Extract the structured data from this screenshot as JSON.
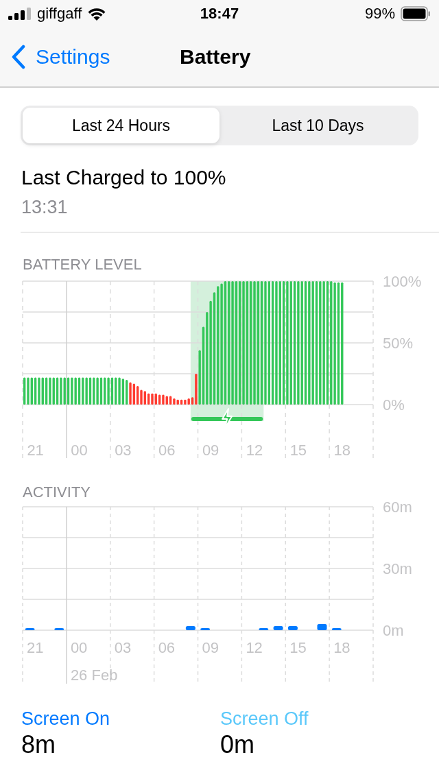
{
  "status_bar": {
    "carrier": "giffgaff",
    "time": "18:47",
    "battery": "99%"
  },
  "nav": {
    "back": "Settings",
    "title": "Battery"
  },
  "tabs": [
    {
      "label": "Last 24 Hours",
      "selected": true
    },
    {
      "label": "Last 10 Days",
      "selected": false
    }
  ],
  "last_charged": {
    "title": "Last Charged to 100%",
    "time": "13:31"
  },
  "battery_level": {
    "heading": "BATTERY LEVEL",
    "chart_data": {
      "type": "bar",
      "ylim": [
        0,
        100
      ],
      "categories": [
        null,
        null,
        null,
        "21",
        null,
        null,
        null,
        null,
        null,
        null,
        null,
        null,
        null,
        null,
        null,
        "00",
        null,
        null,
        null,
        null,
        null,
        null,
        null,
        null,
        null,
        null,
        null,
        "03",
        null,
        null,
        null,
        null,
        null,
        null,
        null,
        null,
        null,
        null,
        null,
        "06",
        null,
        null,
        null,
        null,
        null,
        null,
        null,
        null,
        null,
        null,
        null,
        "09",
        null,
        null,
        null,
        null,
        null,
        null,
        null,
        null,
        null,
        null,
        null,
        "12",
        null,
        null,
        null,
        null,
        null,
        null,
        null,
        null,
        null,
        null,
        null,
        "15",
        null,
        null,
        null,
        null,
        null,
        null,
        null,
        null,
        null,
        null,
        null,
        "18",
        null,
        null,
        null,
        null,
        null,
        null,
        null,
        null
      ],
      "yticks": [
        {
          "value": 0,
          "label": "0%"
        },
        {
          "value": 50,
          "label": "50%"
        },
        {
          "value": 100,
          "label": "100%"
        }
      ],
      "series": [
        {
          "color": "#34c759",
          "values": [
            22,
            22,
            22,
            22,
            22,
            22,
            22,
            22,
            22,
            22,
            22,
            22,
            22,
            22,
            22,
            22,
            22,
            22,
            22,
            22,
            22,
            22,
            22,
            22,
            22,
            22,
            22,
            21,
            20,
            null,
            null,
            null,
            null,
            null,
            null,
            null,
            null,
            null,
            null,
            null,
            null,
            null,
            null,
            null,
            null,
            null,
            null,
            null,
            44,
            63,
            75,
            84,
            91,
            96,
            98,
            100,
            100,
            100,
            100,
            100,
            100,
            100,
            100,
            100,
            100,
            100,
            100,
            100,
            100,
            100,
            100,
            100,
            100,
            100,
            100,
            100,
            100,
            100,
            100,
            100,
            100,
            100,
            100,
            100,
            100,
            99,
            99,
            99,
            null,
            null,
            null,
            null,
            null,
            null,
            null,
            null
          ]
        },
        {
          "color": "#ff3b30",
          "values": [
            null,
            null,
            null,
            null,
            null,
            null,
            null,
            null,
            null,
            null,
            null,
            null,
            null,
            null,
            null,
            null,
            null,
            null,
            null,
            null,
            null,
            null,
            null,
            null,
            null,
            null,
            null,
            null,
            null,
            18,
            17,
            15,
            12,
            11,
            9,
            9,
            9,
            8,
            8,
            7,
            7,
            5,
            4,
            4,
            4,
            5,
            6,
            25,
            null,
            null,
            null,
            null,
            null,
            null,
            null,
            null,
            null,
            null,
            null,
            null,
            null,
            null,
            null,
            null,
            null,
            null,
            null,
            null,
            null,
            null,
            null,
            null,
            null,
            null,
            null,
            null,
            null,
            null,
            null,
            null,
            null,
            null,
            null,
            null,
            null,
            null,
            null,
            null,
            null,
            null,
            null,
            null,
            null,
            null,
            null,
            null
          ]
        }
      ],
      "grid": true
    }
  },
  "activity": {
    "heading": "ACTIVITY",
    "chart_data": {
      "type": "bar",
      "ylim": [
        0,
        60
      ],
      "categories": [
        "21",
        null,
        null,
        "00",
        null,
        null,
        "03",
        null,
        null,
        "06",
        null,
        null,
        "09",
        null,
        null,
        "12",
        null,
        null,
        "15",
        null,
        null,
        "18",
        null,
        null
      ],
      "yticks": [
        {
          "value": 0,
          "label": "0m"
        },
        {
          "value": 30,
          "label": "30m"
        },
        {
          "value": 60,
          "label": "60m"
        }
      ],
      "series": [
        {
          "color": "#007aff",
          "values": [
            1,
            0,
            1,
            0,
            0,
            0,
            0,
            0,
            0,
            0,
            0,
            2,
            1,
            0,
            0,
            0,
            1,
            2,
            2,
            0,
            3,
            1,
            null,
            null
          ]
        }
      ],
      "grid": true,
      "annotations": [
        "26 Feb"
      ]
    }
  },
  "legend": [
    {
      "label": "Screen On",
      "value": "8m",
      "color": "#007aff"
    },
    {
      "label": "Screen Off",
      "value": "0m",
      "color": "#5ac8fa"
    }
  ]
}
